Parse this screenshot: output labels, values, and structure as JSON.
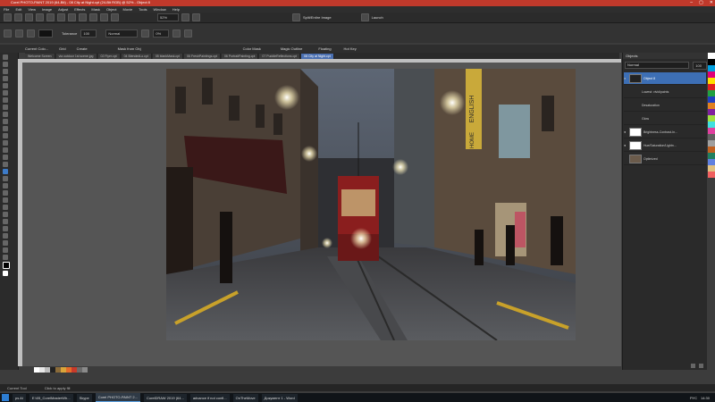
{
  "window": {
    "title": "Corel PHOTO-PAINT 2019 (64-Bit) - 08 City at Night.cpt (24-Bit RGB) @ 52% - Object 8",
    "controls": [
      "–",
      "▢",
      "✕"
    ]
  },
  "menu": [
    "File",
    "Edit",
    "View",
    "Image",
    "Adjust",
    "Effects",
    "Mask",
    "Object",
    "Movie",
    "Tools",
    "Window",
    "Help"
  ],
  "toolbar1": {
    "zoom": "52%",
    "split_label": "Split/Entire Image",
    "launch_label": "Launch"
  },
  "toolbar2": {
    "tolerance_label": "Tolerance",
    "tolerance_value": "100",
    "mode_value": "Normal",
    "percent_value": "0%"
  },
  "toolbar3": {
    "items": [
      "Current Colo...",
      "Grid",
      "Create",
      "Mask from Obj",
      "Color Mask",
      "Magic Outline",
      "Floating",
      "Hot Key"
    ]
  },
  "doc_tabs": [
    {
      "label": "Welcome Screen",
      "active": false
    },
    {
      "label": "via outdoor 1st scene.jpg",
      "active": false
    },
    {
      "label": "02 Flyer.cpt",
      "active": false
    },
    {
      "label": "04 BlendedLo.cpt",
      "active": false
    },
    {
      "label": "05 blankMask.cpt",
      "active": false
    },
    {
      "label": "06 FreshPaintings.cpt",
      "active": false
    },
    {
      "label": "06 PortraitPainting.cpt",
      "active": false
    },
    {
      "label": "07 PuddleReflections.cpt",
      "active": false
    },
    {
      "label": "08 City at Night.cpt",
      "active": true
    }
  ],
  "objects_panel": {
    "title": "Objects",
    "mode": "Normal",
    "opacity": "100",
    "rows": [
      {
        "label": "Object 8",
        "thumb": "dark",
        "active": true
      },
      {
        "label": "Lowest: vivid/paints",
        "thumb": "none",
        "active": false
      },
      {
        "label": "Desaturation",
        "thumb": "none",
        "active": false
      },
      {
        "label": "Glow",
        "thumb": "none",
        "active": false
      },
      {
        "label": "Brightness-Contrast-In...",
        "thumb": "white",
        "active": false
      },
      {
        "label": "Hue/Saturation/Lightn...",
        "thumb": "white",
        "active": false
      },
      {
        "label": "Optimized",
        "thumb": "photo",
        "active": false
      }
    ]
  },
  "photo": {
    "sign_text": "ENGLISH",
    "sign_text2": "HOME"
  },
  "status": {
    "left": "Current Tool",
    "hint": "Click to apply fill"
  },
  "taskbar": {
    "items": [
      {
        "label": "ps AI",
        "active": false
      },
      {
        "label": "E:\\05_CorelMasterWh...",
        "active": false
      },
      {
        "label": "Skype",
        "active": false
      },
      {
        "label": "Corel PHOTO-PAINT 2...",
        "active": true
      },
      {
        "label": "CorelDRAW 2019 (64...",
        "active": false
      },
      {
        "label": "advance if not confi...",
        "active": false
      },
      {
        "label": "OnTheMove",
        "active": false
      },
      {
        "label": "Документ 1 - Word",
        "active": false
      }
    ],
    "tray_lang": "РУС",
    "tray_time": "14:30"
  },
  "colors": {
    "titlebar": "#c0392b",
    "accent": "#3d6fb5"
  }
}
